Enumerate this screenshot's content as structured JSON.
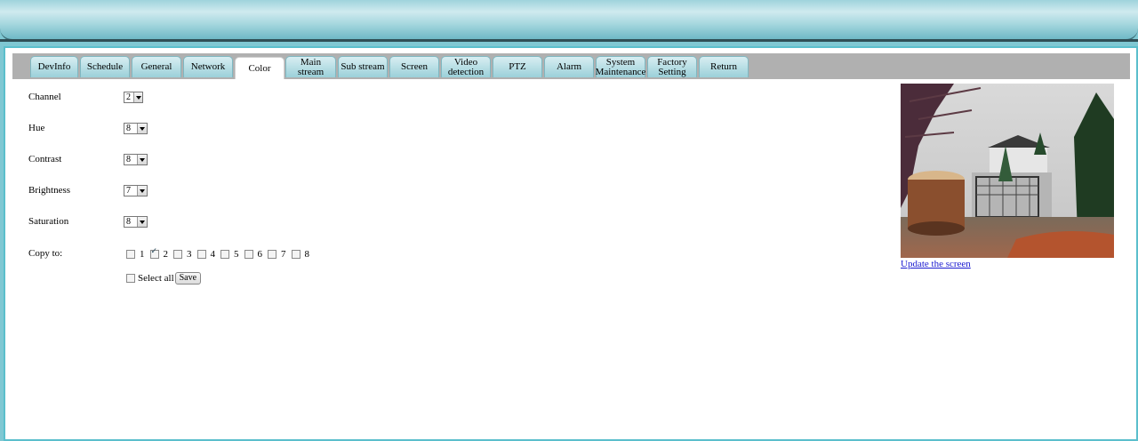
{
  "tabs": [
    {
      "label": "DevInfo",
      "active": false
    },
    {
      "label": "Schedule",
      "active": false
    },
    {
      "label": "General",
      "active": false
    },
    {
      "label": "Network",
      "active": false
    },
    {
      "label": "Color",
      "active": true
    },
    {
      "label": "Main stream",
      "active": false
    },
    {
      "label": "Sub stream",
      "active": false
    },
    {
      "label": "Screen",
      "active": false
    },
    {
      "label": "Video\ndetection",
      "active": false
    },
    {
      "label": "PTZ",
      "active": false
    },
    {
      "label": "Alarm",
      "active": false
    },
    {
      "label": "System\nMaintenance",
      "active": false
    },
    {
      "label": "Factory\nSetting",
      "active": false
    },
    {
      "label": "Return",
      "active": false
    }
  ],
  "form": {
    "channel": {
      "label": "Channel",
      "value": "2"
    },
    "hue": {
      "label": "Hue",
      "value": "8"
    },
    "contrast": {
      "label": "Contrast",
      "value": "8"
    },
    "brightness": {
      "label": "Brightness",
      "value": "7"
    },
    "saturation": {
      "label": "Saturation",
      "value": "8"
    }
  },
  "copy_to": {
    "label": "Copy to:",
    "channels": [
      {
        "num": "1",
        "checked": false
      },
      {
        "num": "2",
        "checked": true
      },
      {
        "num": "3",
        "checked": false
      },
      {
        "num": "4",
        "checked": false
      },
      {
        "num": "5",
        "checked": false
      },
      {
        "num": "6",
        "checked": false
      },
      {
        "num": "7",
        "checked": false
      },
      {
        "num": "8",
        "checked": false
      }
    ],
    "select_all_label": "Select all",
    "save_label": "Save"
  },
  "preview": {
    "update_label": "Update the screen"
  },
  "colors": {
    "accent": "#5bbfcc",
    "tab_bar": "#b0b0b0",
    "link": "#1a1ad0"
  }
}
